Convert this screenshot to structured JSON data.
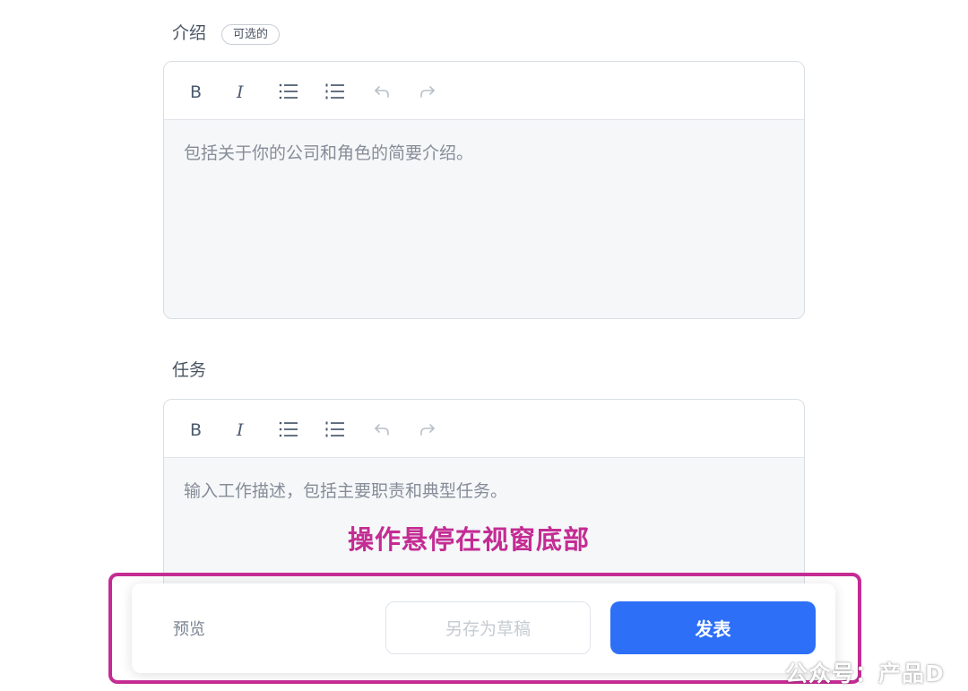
{
  "intro_section": {
    "label": "介绍",
    "optional_badge": "可选的",
    "placeholder": "包括关于你的公司和角色的简要介绍。"
  },
  "tasks_section": {
    "label": "任务",
    "placeholder": "输入工作描述，包括主要职责和典型任务。"
  },
  "toolbar_icons": [
    "bold-icon",
    "italic-icon",
    "bullet-list-icon",
    "numbered-list-icon",
    "undo-icon",
    "redo-icon"
  ],
  "annotation": "操作悬停在视窗底部",
  "action_bar": {
    "preview_label": "预览",
    "save_draft_label": "另存为草稿",
    "publish_label": "发表"
  },
  "watermark": "公众号：产品D",
  "colors": {
    "primary": "#2d6ff7",
    "annotation": "#c42c93",
    "editor_body_bg": "#f5f7f9"
  }
}
